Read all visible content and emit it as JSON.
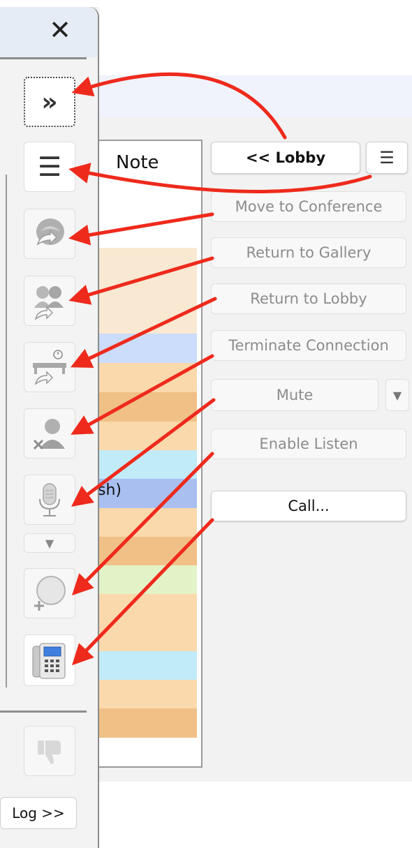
{
  "sidebar": {
    "close_glyph": "✕",
    "expand_glyph": "»",
    "menu_glyph": "☰",
    "dropdown_glyph": "▼",
    "log_label": "Log >>"
  },
  "note_column": {
    "header": "Note",
    "partial_text": "sh)",
    "row_colors": [
      "#f9e8d2",
      "#f9e8d2",
      "#f9e8d2",
      "#ccdcfb",
      "#fad9ac",
      "#f0c087",
      "#fad9ac",
      "#c1ebf9",
      "#a8bff0",
      "#fad9ac",
      "#f0c087",
      "#e2f3c7",
      "#fad9ac",
      "#fad9ac",
      "#c1ebf9",
      "#fad9ac",
      "#f0c087"
    ]
  },
  "right_panel": {
    "lobby_label": "<< Lobby",
    "menu_glyph": "☰",
    "buttons": [
      {
        "label": "Move to Conference"
      },
      {
        "label": "Return to Gallery"
      },
      {
        "label": "Return to Lobby"
      },
      {
        "label": "Terminate Connection"
      },
      {
        "label": "Mute"
      },
      {
        "label": "Enable Listen"
      },
      {
        "label": "Call..."
      }
    ],
    "dropdown_glyph": "▼"
  },
  "colors": {
    "arrow": "#ee2a1c",
    "row_hover": "#f9e8d2"
  }
}
